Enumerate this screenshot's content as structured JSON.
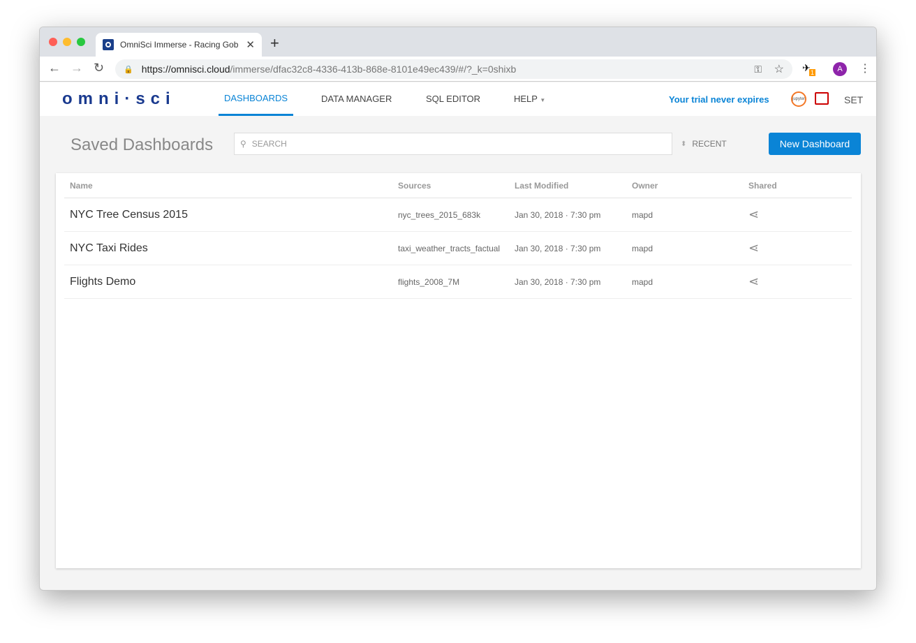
{
  "browser": {
    "tab_title": "OmniSci Immerse - Racing Gob",
    "url_host": "https://omnisci.cloud",
    "url_path": "/immerse/dfac32c8-4336-413b-868e-8101e49ec439/#/?_k=0shixb",
    "extension_badge": "1",
    "profile_initial": "A"
  },
  "app": {
    "logo": "omni·sci",
    "menu": [
      "DASHBOARDS",
      "DATA MANAGER",
      "SQL EDITOR",
      "HELP"
    ],
    "trial": "Your trial never expires",
    "jupyter": "jupyter",
    "settings": "SET"
  },
  "main": {
    "title": "Saved Dashboards",
    "search_placeholder": "SEARCH",
    "sort": "RECENT",
    "new_button": "New Dashboard"
  },
  "table": {
    "headers": [
      "Name",
      "Sources",
      "Last Modified",
      "Owner",
      "Shared"
    ],
    "rows": [
      {
        "name": "NYC Tree Census 2015",
        "source": "nyc_trees_2015_683k",
        "modified": "Jan 30, 2018 · 7:30 pm",
        "owner": "mapd"
      },
      {
        "name": "NYC Taxi Rides",
        "source": "taxi_weather_tracts_factual",
        "modified": "Jan 30, 2018 · 7:30 pm",
        "owner": "mapd"
      },
      {
        "name": "Flights Demo",
        "source": "flights_2008_7M",
        "modified": "Jan 30, 2018 · 7:30 pm",
        "owner": "mapd"
      }
    ]
  }
}
